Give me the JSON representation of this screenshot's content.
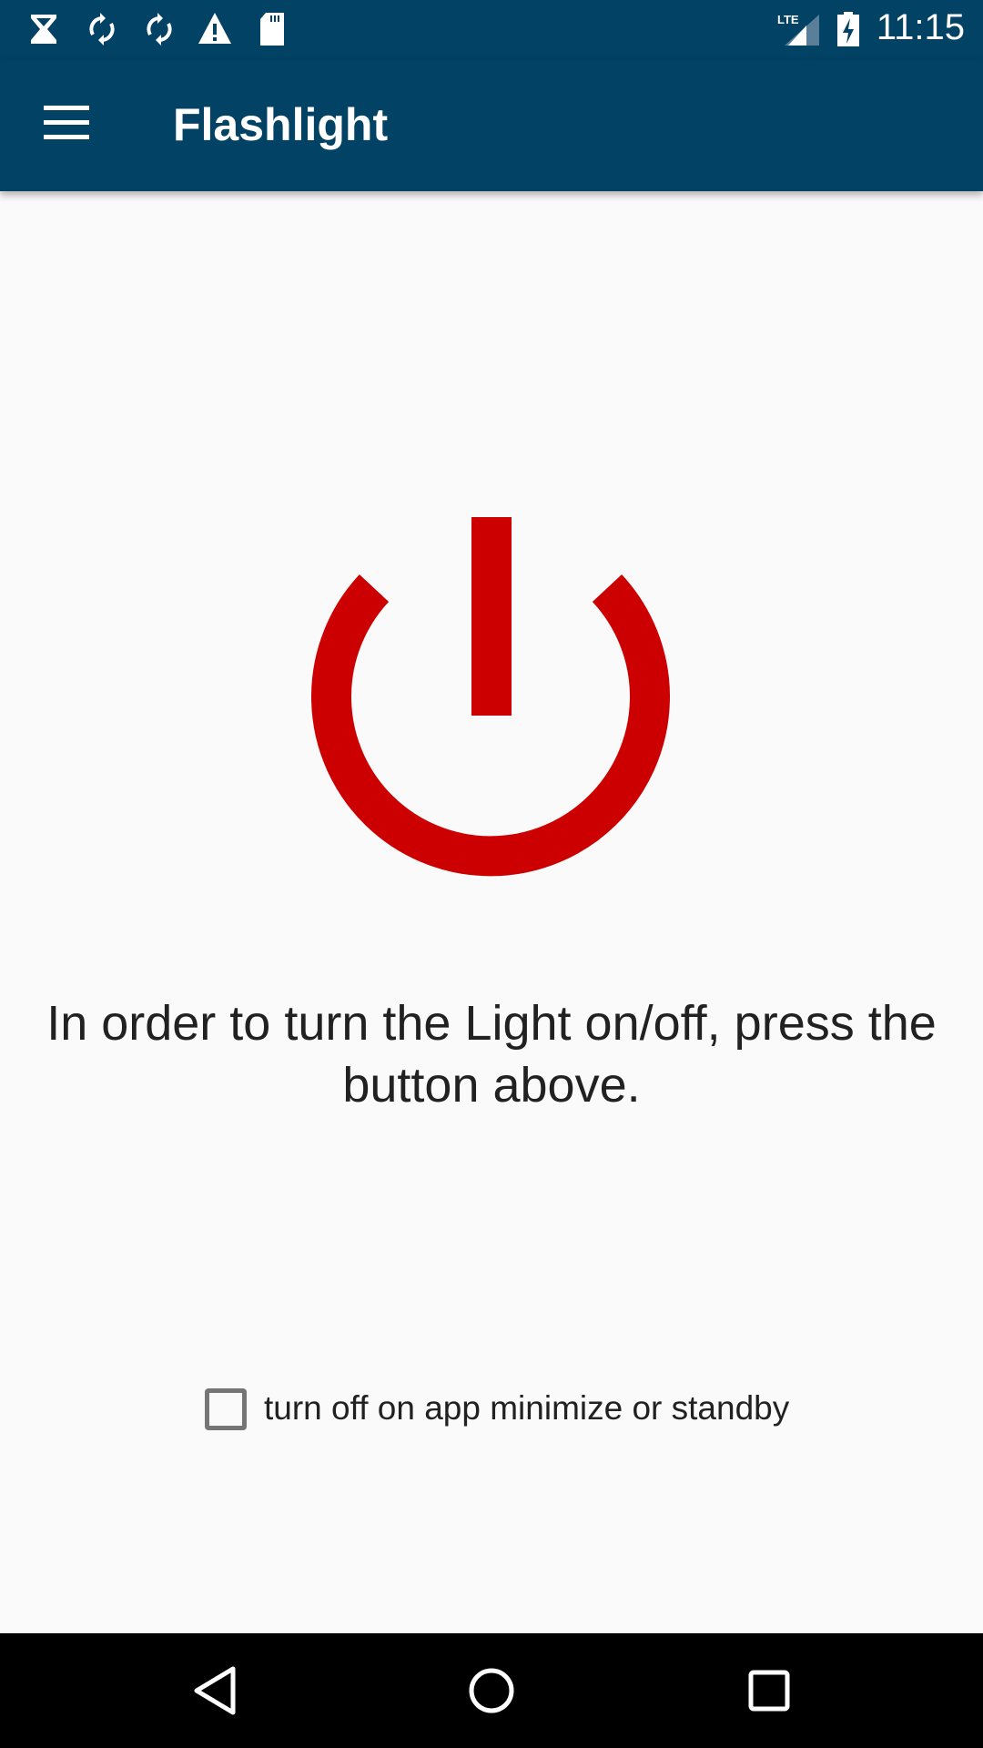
{
  "status_bar": {
    "time": "11:15",
    "network": "LTE",
    "icons": [
      "hourglass-icon",
      "sync-icon",
      "sync-icon",
      "warning-icon",
      "sd-card-icon",
      "lte-signal-icon",
      "battery-charging-icon"
    ]
  },
  "app_bar": {
    "title": "Flashlight",
    "menu_icon": "hamburger-menu-icon"
  },
  "main": {
    "power_button_icon": "power-icon",
    "power_color": "#cc0000",
    "instruction": "In order to turn the Light on/off, press the button above.",
    "checkbox": {
      "label": "turn off on app minimize or standby",
      "checked": false
    }
  },
  "colors": {
    "primary": "#024264"
  },
  "nav_bar": {
    "icons": [
      "back-icon",
      "home-icon",
      "recents-icon"
    ]
  }
}
